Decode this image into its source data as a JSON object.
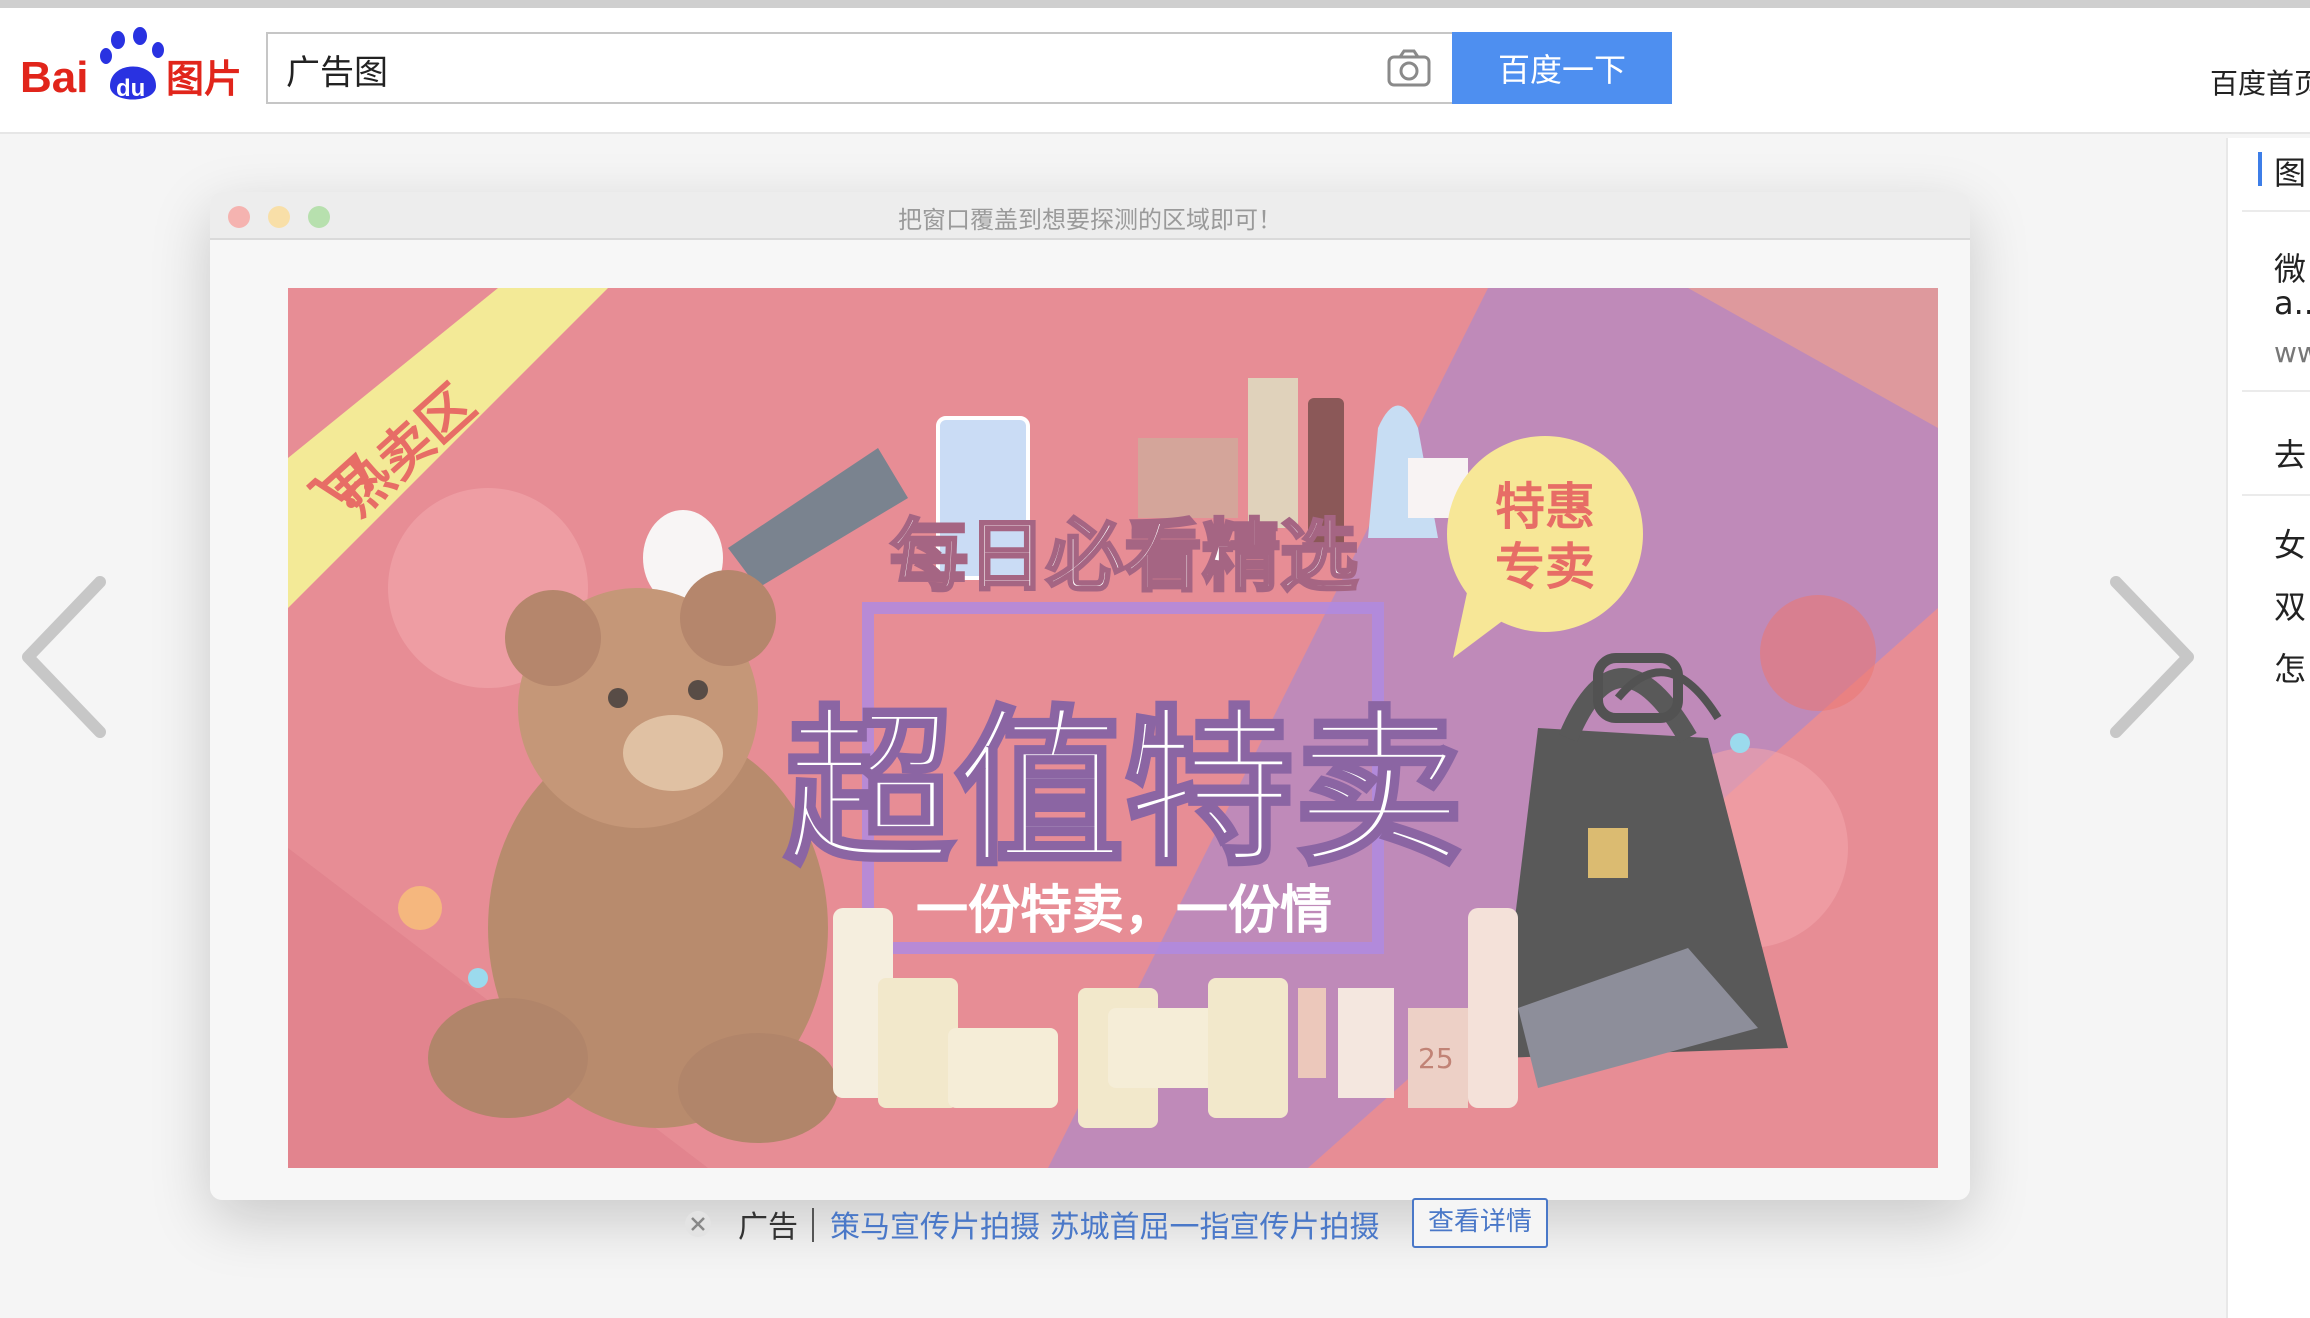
{
  "header": {
    "logo_text_bai": "Bai",
    "logo_text_du": "du",
    "logo_text_images": "图片",
    "search_value": "广告图",
    "search_button": "百度一下",
    "home_link": "百度首页"
  },
  "right_panel": {
    "section_title": "图",
    "item1_line1": "微",
    "item1_line2": "a...",
    "item1_url": "ww",
    "section2_title": "去",
    "links": [
      "女",
      "双",
      "怎"
    ]
  },
  "window": {
    "title": "把窗口覆盖到想要探测的区域即可！"
  },
  "banner": {
    "ribbon_text": "热卖区",
    "headline_top": "每日必看精选",
    "headline_main": "超值特卖",
    "subline": "一份特卖，一份情",
    "badge_line1": "特惠",
    "badge_line2": "专卖",
    "product_label": "25"
  },
  "ad": {
    "label": "广告",
    "link_text": "策马宣传片拍摄 苏城首屈一指宣传片拍摄",
    "details_button": "查看详情"
  },
  "colors": {
    "brand_red": "#e1251b",
    "brand_blue": "#2932e1",
    "search_button": "#4e8ff0",
    "link_blue": "#4a78c8",
    "banner_bg": "#e06e78"
  },
  "icons": {
    "camera": "camera-icon",
    "prev": "chevron-left-icon",
    "next": "chevron-right-icon",
    "close": "close-icon",
    "cart": "cart-icon"
  }
}
